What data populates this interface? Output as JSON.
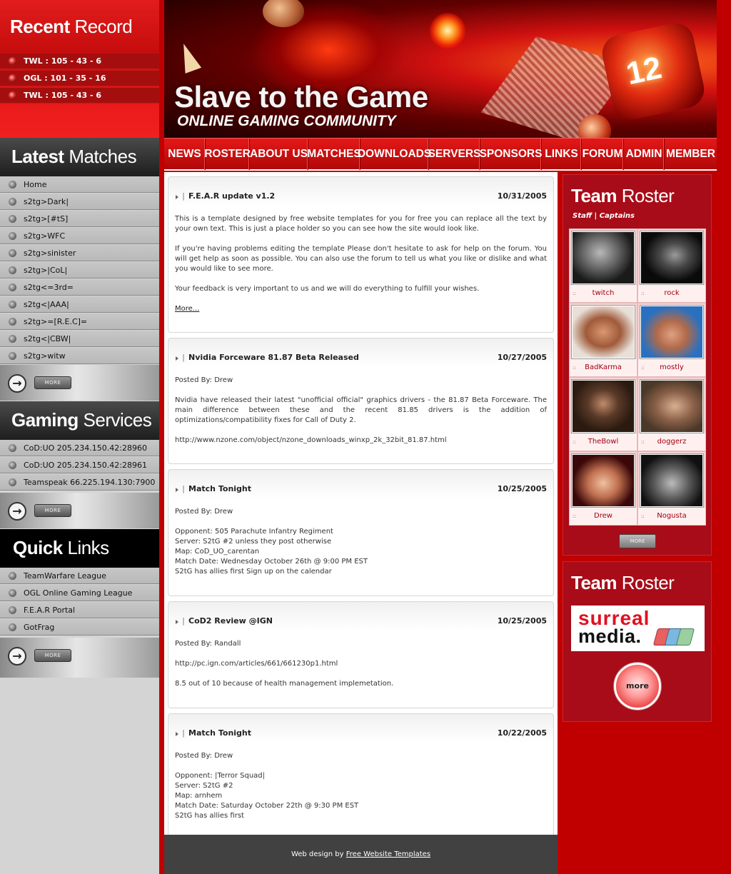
{
  "left": {
    "recent_record": {
      "title_bold": "Recent",
      "title_light": "Record",
      "items": [
        "TWL : 105 - 43 - 6",
        "OGL : 101 - 35 - 16",
        "TWL : 105 - 43 - 6"
      ]
    },
    "latest_matches": {
      "title_bold": "Latest",
      "title_light": "Matches",
      "items": [
        "Home",
        "s2tg>Dark|",
        "s2tg>[#tS]",
        "s2tg>WFC",
        "s2tg>sinister",
        "s2tg>|CoL|",
        "s2tg<=3rd=",
        "s2tg<|AAA|",
        "s2tg>=[R.E.C]=",
        "s2tg<|CBW|",
        "s2tg>witw"
      ],
      "more": "MORE"
    },
    "gaming_services": {
      "title_bold": "Gaming",
      "title_light": "Services",
      "items": [
        "CoD:UO 205.234.150.42:28960",
        "CoD:UO 205.234.150.42:28961",
        "Teamspeak 66.225.194.130:7900"
      ],
      "more": "MORE"
    },
    "quick_links": {
      "title_bold": "Quick",
      "title_light": "Links",
      "items": [
        "TeamWarfare League",
        "OGL Online Gaming League",
        "F.E.A.R Portal",
        "GotFrag"
      ],
      "more": "MORE"
    }
  },
  "banner": {
    "title": "Slave to the Game",
    "subtitle": "ONLINE GAMING COMMUNITY",
    "die_number": "12"
  },
  "nav": [
    "NEWS",
    "ROSTER",
    "ABOUT US",
    "MATCHES",
    "DOWNLOADS",
    "SERVERS",
    "SPONSORS",
    "LINKS",
    "FORUM",
    "ADMIN",
    "MEMBER"
  ],
  "posts": [
    {
      "title": "F.E.A.R update v1.2",
      "date": "10/31/2005",
      "paragraphs": [
        "This is a template designed by free website templates for you for free you can replace all the text by your own text. This is just a place holder so you can see how the site would look like.",
        "If you're having problems editing the template Please don't hesitate to ask for help on the forum. You will get help as soon as possible. You can also use the forum to tell us what you like or dislike and what you would like to see more.",
        "Your feedback is very important to us and we will do everything to fulfill your wishes."
      ],
      "more": "More..."
    },
    {
      "title": "Nvidia Forceware 81.87 Beta Released",
      "date": "10/27/2005",
      "paragraphs": [
        "Posted By: Drew",
        "Nvidia have released their latest \"unofficial official\" graphics drivers - the 81.87 Beta Forceware. The main difference between these and the recent 81.85 drivers is the addition of optimizations/compatibility fixes for Call of Duty 2.",
        "http://www.nzone.com/object/nzone_downloads_winxp_2k_32bit_81.87.html"
      ]
    },
    {
      "title": "Match Tonight",
      "date": "10/25/2005",
      "paragraphs": [
        "Posted By: Drew"
      ],
      "lines": [
        "Opponent: 505 Parachute Infantry Regiment",
        "Server: S2tG #2 unless they post otherwise",
        "Map: CoD_UO_carentan",
        "Match Date: Wednesday October 26th @ 9:00 PM EST",
        "S2tG has allies first Sign up on the calendar"
      ]
    },
    {
      "title": "CoD2 Review @IGN",
      "date": "10/25/2005",
      "paragraphs": [
        "Posted By: Randall",
        "http://pc.ign.com/articles/661/661230p1.html",
        "8.5 out of 10 because of health management implemetation."
      ]
    },
    {
      "title": "Match Tonight",
      "date": "10/22/2005",
      "paragraphs": [
        "Posted By: Drew"
      ],
      "lines": [
        "Opponent: |Terror Squad|",
        "Server: S2tG #2",
        "Map: arnhem",
        "Match Date: Saturday October 22th @ 9:30 PM EST",
        "S2tG has allies first"
      ]
    }
  ],
  "footer": {
    "prefix": "Web design by",
    "link": "Free Website Templates"
  },
  "roster": {
    "title_bold": "Team",
    "title_light": "Roster",
    "staff": "Staff",
    "captains": "Captains",
    "members": [
      "twitch",
      "rock",
      "BadKarma",
      "mostly",
      "TheBowl",
      "doggerz",
      "Drew",
      "Nogusta"
    ],
    "more": "MORE"
  },
  "sponsor": {
    "title_bold": "Team",
    "title_light": "Roster",
    "logo_top": "surreal",
    "logo_bottom": "media.",
    "more": "more"
  },
  "colors": {
    "brand_red": "#c00000",
    "panel_red": "#a80c18",
    "footer_gray": "#414141"
  }
}
